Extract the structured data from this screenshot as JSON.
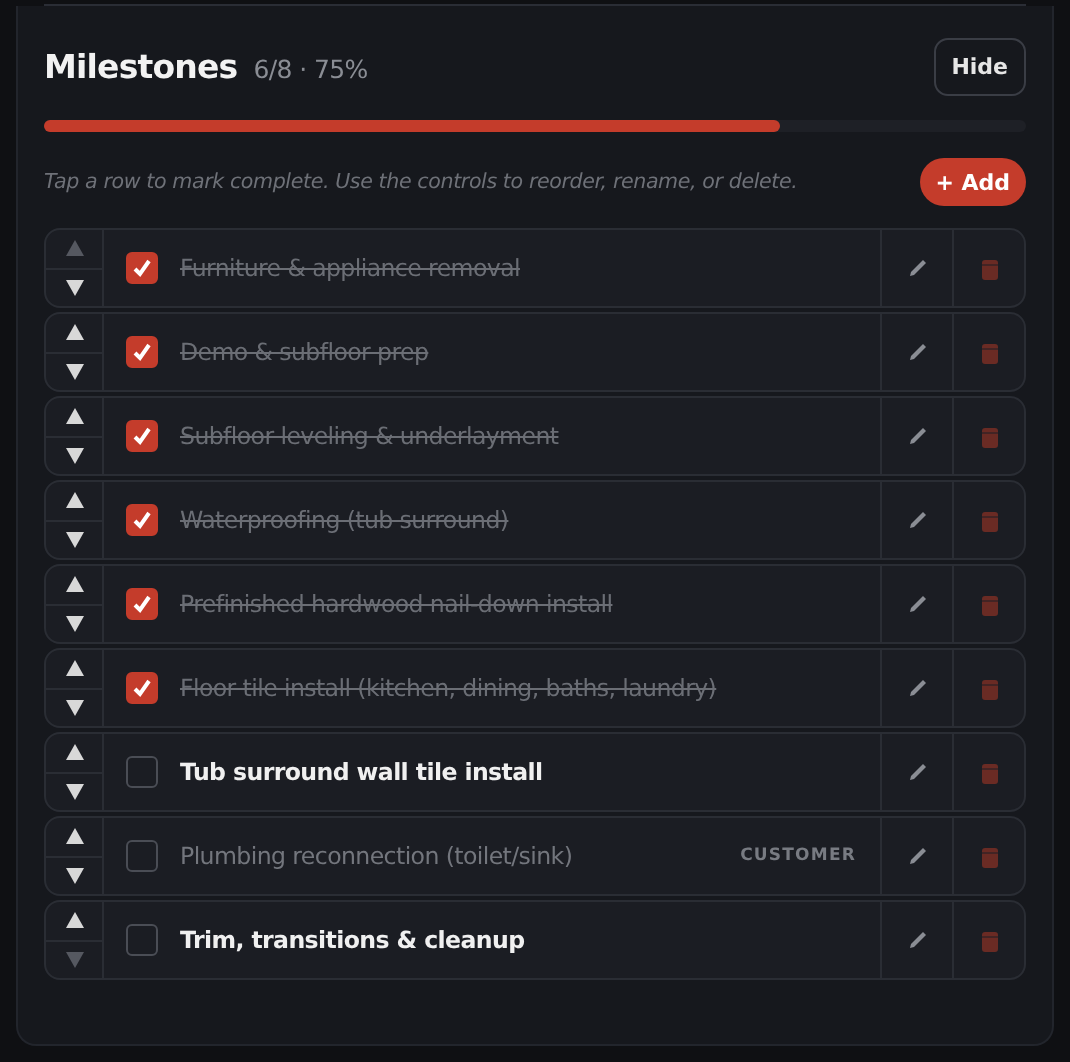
{
  "header": {
    "title": "Milestones",
    "summary": "6/8 · 75%",
    "hide_button": "Hide"
  },
  "progress": {
    "level": 0.75
  },
  "hint": "Tap a row to mark complete. Use the controls to reorder, rename, or delete.",
  "add_button": "+ Add",
  "milestones": [
    {
      "label": "Furniture & appliance removal",
      "checked": true,
      "disabled": false,
      "up_disabled": true,
      "down_disabled": false
    },
    {
      "label": "Demo & subfloor prep",
      "checked": true,
      "disabled": false,
      "up_disabled": false,
      "down_disabled": false
    },
    {
      "label": "Subfloor leveling & underlayment",
      "checked": true,
      "disabled": false,
      "up_disabled": false,
      "down_disabled": false
    },
    {
      "label": "Waterproofing (tub surround)",
      "checked": true,
      "disabled": false,
      "up_disabled": false,
      "down_disabled": false
    },
    {
      "label": "Prefinished hardwood nail-down install",
      "checked": true,
      "disabled": false,
      "up_disabled": false,
      "down_disabled": false
    },
    {
      "label": "Floor tile install (kitchen, dining, baths, laundry)",
      "checked": true,
      "disabled": false,
      "up_disabled": false,
      "down_disabled": false
    },
    {
      "label": "Tub surround wall tile install",
      "checked": false,
      "disabled": false,
      "up_disabled": false,
      "down_disabled": false
    },
    {
      "label": "Plumbing reconnection (toilet/sink)",
      "checked": false,
      "disabled": true,
      "tag": "CUSTOMER",
      "up_disabled": false,
      "down_disabled": false
    },
    {
      "label": "Trim, transitions & cleanup",
      "checked": false,
      "disabled": false,
      "up_disabled": false,
      "down_disabled": true
    }
  ]
}
